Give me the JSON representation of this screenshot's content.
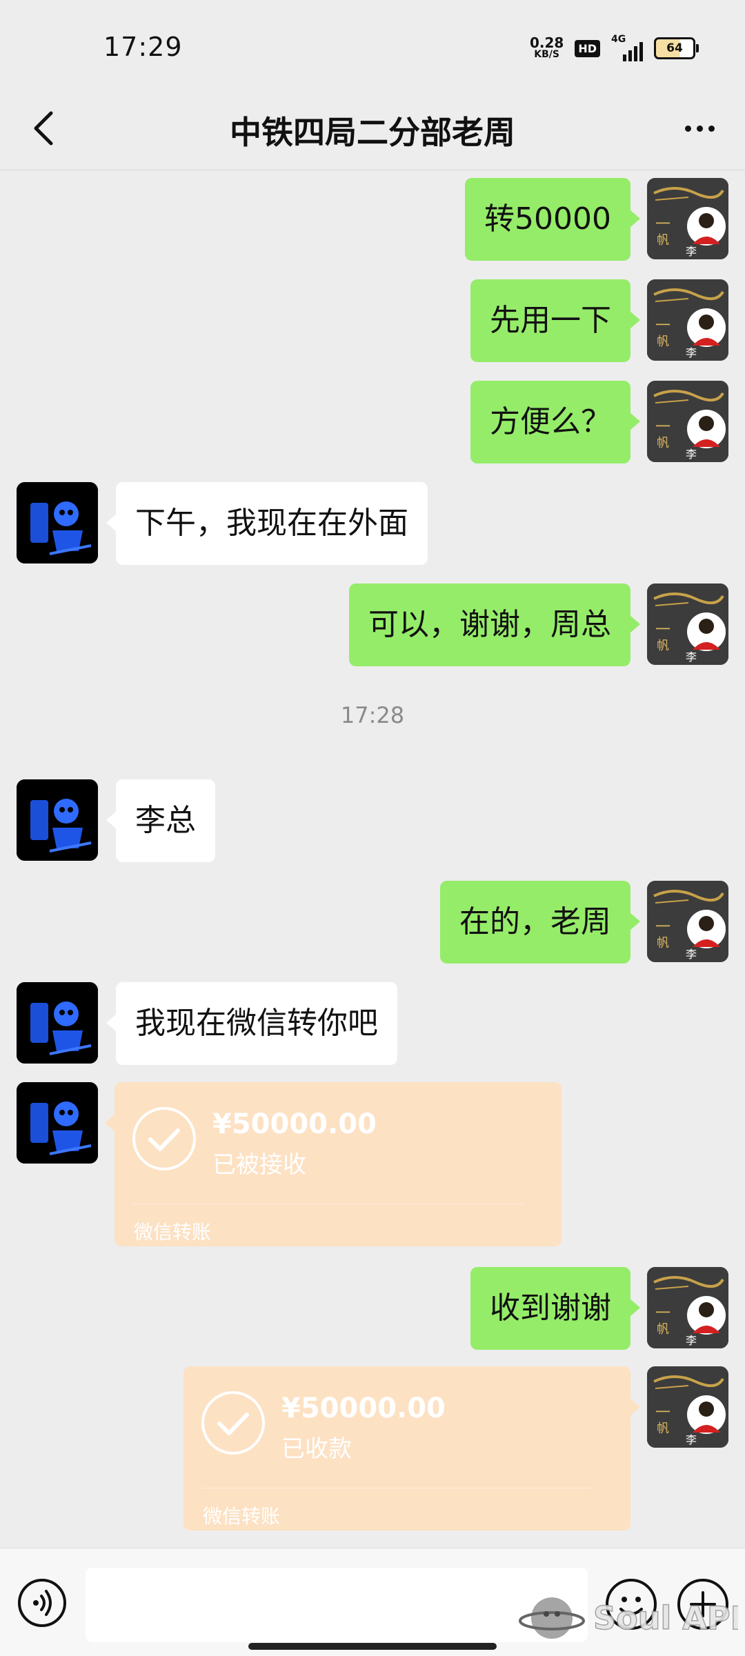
{
  "status_bar": {
    "time": "17:29",
    "net_speed": "0.28",
    "net_unit": "KB/S",
    "hd": "HD",
    "network": "4G",
    "battery": "64"
  },
  "header": {
    "title": "中铁四局二分部老周"
  },
  "colors": {
    "my_bubble": "#95ec69",
    "their_bubble": "#ffffff",
    "transfer_card": "#fde1c3",
    "background": "#ededed"
  },
  "messages": [
    {
      "from": "me",
      "text": "转50000"
    },
    {
      "from": "me",
      "text": "先用一下"
    },
    {
      "from": "me",
      "text": "方便么？"
    },
    {
      "from": "them",
      "text": "下午，我现在在外面"
    },
    {
      "from": "me",
      "text": "可以，谢谢，周总"
    },
    {
      "from": "them",
      "text": "李总"
    },
    {
      "from": "me",
      "text": "在的，老周"
    },
    {
      "from": "them",
      "text": "我现在微信转你吧"
    },
    {
      "from": "me",
      "text": "收到谢谢"
    }
  ],
  "timestamp": "17:28",
  "transfers": [
    {
      "from": "them",
      "amount": "¥50000.00",
      "status": "已被接收",
      "footer": "微信转账"
    },
    {
      "from": "me",
      "amount": "¥50000.00",
      "status": "已收款",
      "footer": "微信转账"
    }
  ],
  "avatar_mine_char": "李",
  "watermark": "Soul APP",
  "icons": {
    "back": "chevron-left-icon",
    "more": "more-dots-icon",
    "voice": "voice-icon",
    "emoji": "emoji-icon",
    "plus": "plus-icon"
  }
}
